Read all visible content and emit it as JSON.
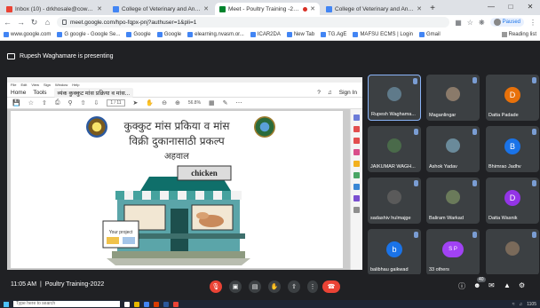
{
  "browser": {
    "tabs": [
      {
        "title": "Inbox (10) - drkhosale@cowayu",
        "favicon_color": "#ea4335",
        "active": false
      },
      {
        "title": "College of Veterinary and Animal",
        "favicon_color": "#4285f4",
        "active": false
      },
      {
        "title": "Meet - Poultry Training -2022",
        "favicon_color": "#00832d",
        "active": true,
        "recording": true
      },
      {
        "title": "College of Veterinary and Anima",
        "favicon_color": "#4285f4",
        "active": false
      }
    ],
    "new_tab": "+",
    "url": "meet.google.com/hpo-fqpx-pnj?authuser=1&pli=1",
    "profile_status": "Paused",
    "bookmarks": [
      "www.google.com",
      "G google - Google Se...",
      "Google",
      "Google",
      "elearning.nvasm.or...",
      "ICAR2DA",
      "New Tab",
      "TG.AgE",
      "MAFSU ECMS | Login",
      "Gmail"
    ],
    "reading_list": "Reading list"
  },
  "meet": {
    "presenter_text": "Rupesh Waghamare is presenting",
    "meeting_time": "11:05 AM",
    "meeting_name": "Poultry Training-2022",
    "participant_count": "40"
  },
  "shared_screen": {
    "menu": [
      "File",
      "Edit",
      "View",
      "Sign",
      "Window",
      "Help"
    ],
    "tabs": [
      "Home",
      "Tools",
      "व्यंक कुक्कुट मांस प्रक्रिया व मांस..."
    ],
    "sign_in": "Sign In",
    "page_indicator": "1 / 11",
    "zoom": "56.8%",
    "slide": {
      "line1": "कुक्कुट मांस प्रकिया व मांस",
      "line2": "विक्री दुकानासाठी प्रकल्प",
      "line3": "अहवाल",
      "shop_sign": "chicken",
      "shop_card": "Your project"
    }
  },
  "participants": [
    {
      "name": "Rupesh Waghama...",
      "type": "photo",
      "color": "#5f7a8a"
    },
    {
      "name": "Maganlingar",
      "type": "photo",
      "color": "#8a7a6a"
    },
    {
      "name": "Datta Padade",
      "type": "letter",
      "letter": "D",
      "color": "#e8710a"
    },
    {
      "name": "JAIKUMAR WAGH...",
      "type": "photo",
      "color": "#4a6a4a"
    },
    {
      "name": "Ashok Yadav",
      "type": "photo",
      "color": "#6a8a9a"
    },
    {
      "name": "Bhimrao Jadhv",
      "type": "letter",
      "letter": "B",
      "color": "#1a73e8"
    },
    {
      "name": "sadashiv hulmajge",
      "type": "photo",
      "color": "#5a5a5a"
    },
    {
      "name": "Baliram Warkad",
      "type": "photo",
      "color": "#6a7a5a"
    },
    {
      "name": "Datta Wasnik",
      "type": "letter",
      "letter": "D",
      "color": "#9334e6"
    },
    {
      "name": "balibhau gaikwad",
      "type": "letter",
      "letter": "b",
      "color": "#1a73e8"
    },
    {
      "name": "33 others",
      "type": "letters",
      "letter": "S P",
      "color": "#a142f4"
    },
    {
      "name": "",
      "type": "photo",
      "color": "#7a6a5a"
    }
  ],
  "taskbar": {
    "search_placeholder": "Type here to search",
    "clock": "1105"
  }
}
